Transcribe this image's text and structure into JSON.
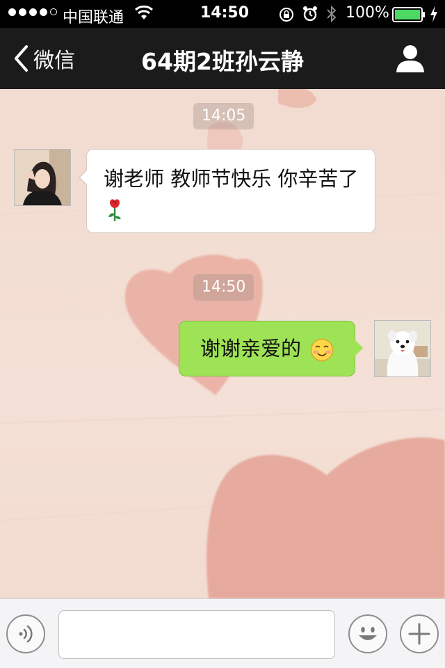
{
  "status_bar": {
    "carrier": "中国联通",
    "time": "14:50",
    "battery_percent": "100%",
    "signal_bars": 4,
    "signal_max": 5,
    "battery_level": 1.0,
    "battery_color": "#4cd964"
  },
  "nav": {
    "back_label": "微信",
    "title": "64期2班孙云静",
    "contact_icon": "person-icon"
  },
  "chat": {
    "messages": [
      {
        "timestamp": "14:05",
        "direction": "incoming",
        "text": "谢老师 教师节快乐 你辛苦了",
        "emoji": "rose-emoji",
        "bubble_color": "#ffffff"
      },
      {
        "timestamp": "14:50",
        "direction": "outgoing",
        "text": "谢谢亲爱的",
        "emoji": "smiling-face-emoji",
        "bubble_color": "#9ee255"
      }
    ]
  },
  "input_bar": {
    "voice_icon": "voice-icon",
    "emoji_icon": "emoji-face-icon",
    "plus_icon": "plus-icon",
    "input_value": ""
  }
}
